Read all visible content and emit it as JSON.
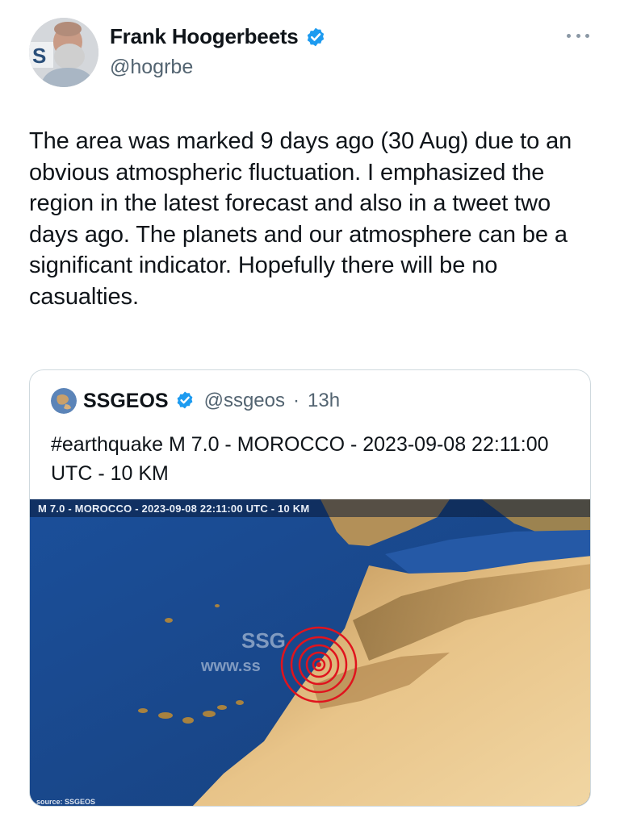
{
  "tweet": {
    "author_name": "Frank Hoogerbeets",
    "author_handle": "@hogrbe",
    "avatar_label": "S",
    "text": "The area was marked 9 days ago (30 Aug) due to an obvious atmospheric fluctuation. I emphasized the region in the latest forecast and also in a tweet two days ago. The planets and our atmosphere can be a significant indicator. Hopefully there will be no casualties."
  },
  "quoted_tweet": {
    "author_name": "SSGEOS",
    "author_handle": "@ssgeos",
    "separator": "·",
    "time_ago": "13h",
    "text": "#earthquake M 7.0 - MOROCCO - 2023-09-08 22:11:00 UTC - 10 KM",
    "map": {
      "caption": "M 7.0 - MOROCCO - 2023-09-08 22:11:00 UTC - 10 KM",
      "watermark_line1": "SSG",
      "watermark_line2": "www.ss",
      "footer": "source: SSGEOS"
    }
  },
  "colors": {
    "verified_blue": "#1d9bf0",
    "text_primary": "#0f1419",
    "text_secondary": "#536471",
    "epicenter_red": "#e0141e"
  },
  "icons": [
    "verified-badge-icon",
    "more-options-icon"
  ]
}
